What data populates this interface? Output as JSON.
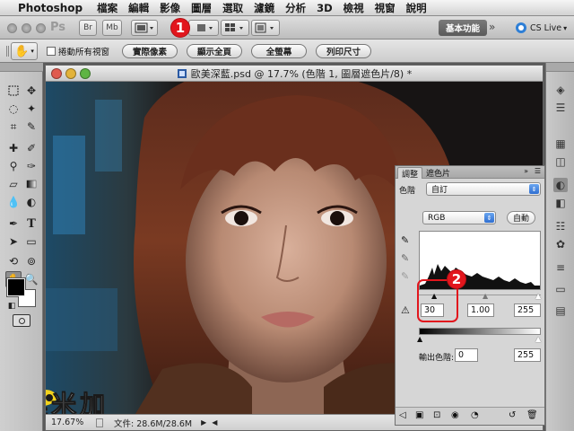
{
  "menubar": {
    "app_name": "Photoshop",
    "items": [
      "檔案",
      "編輯",
      "影像",
      "圖層",
      "選取",
      "濾鏡",
      "分析",
      "3D",
      "檢視",
      "視窗",
      "說明"
    ]
  },
  "appbar": {
    "ps_logo": "Ps",
    "br": "Br",
    "mb": "Mb",
    "workspace_button": "基本功能",
    "overflow": "»",
    "cs_live": "CS Live"
  },
  "options_bar": {
    "scroll_all_windows": "捲動所有視窗",
    "buttons": [
      "實際像素",
      "顯示全頁",
      "全螢幕",
      "列印尺寸"
    ]
  },
  "document": {
    "title": "歐美深藍.psd @ 17.7% (色階 1, 圖層遮色片/8) *",
    "zoom": "17.67%",
    "file_info": "文件: 28.6M/28.6M"
  },
  "adjustments_panel": {
    "tabs": [
      "調整",
      "遮色片"
    ],
    "preset_label": "色階",
    "preset_value": "自訂",
    "channel_value": "RGB",
    "auto_button": "自動",
    "input_black": "30",
    "input_gamma": "1.00",
    "input_white": "255",
    "output_label": "輸出色階:",
    "output_black": "0",
    "output_white": "255"
  },
  "callouts": [
    "1",
    "2"
  ],
  "watermark": {
    "text": "奧米加"
  },
  "colors": {
    "callout_red": "#e2161d",
    "toolbar_grey": "#c8c8c8",
    "photo_background": "#1c1a1a"
  }
}
